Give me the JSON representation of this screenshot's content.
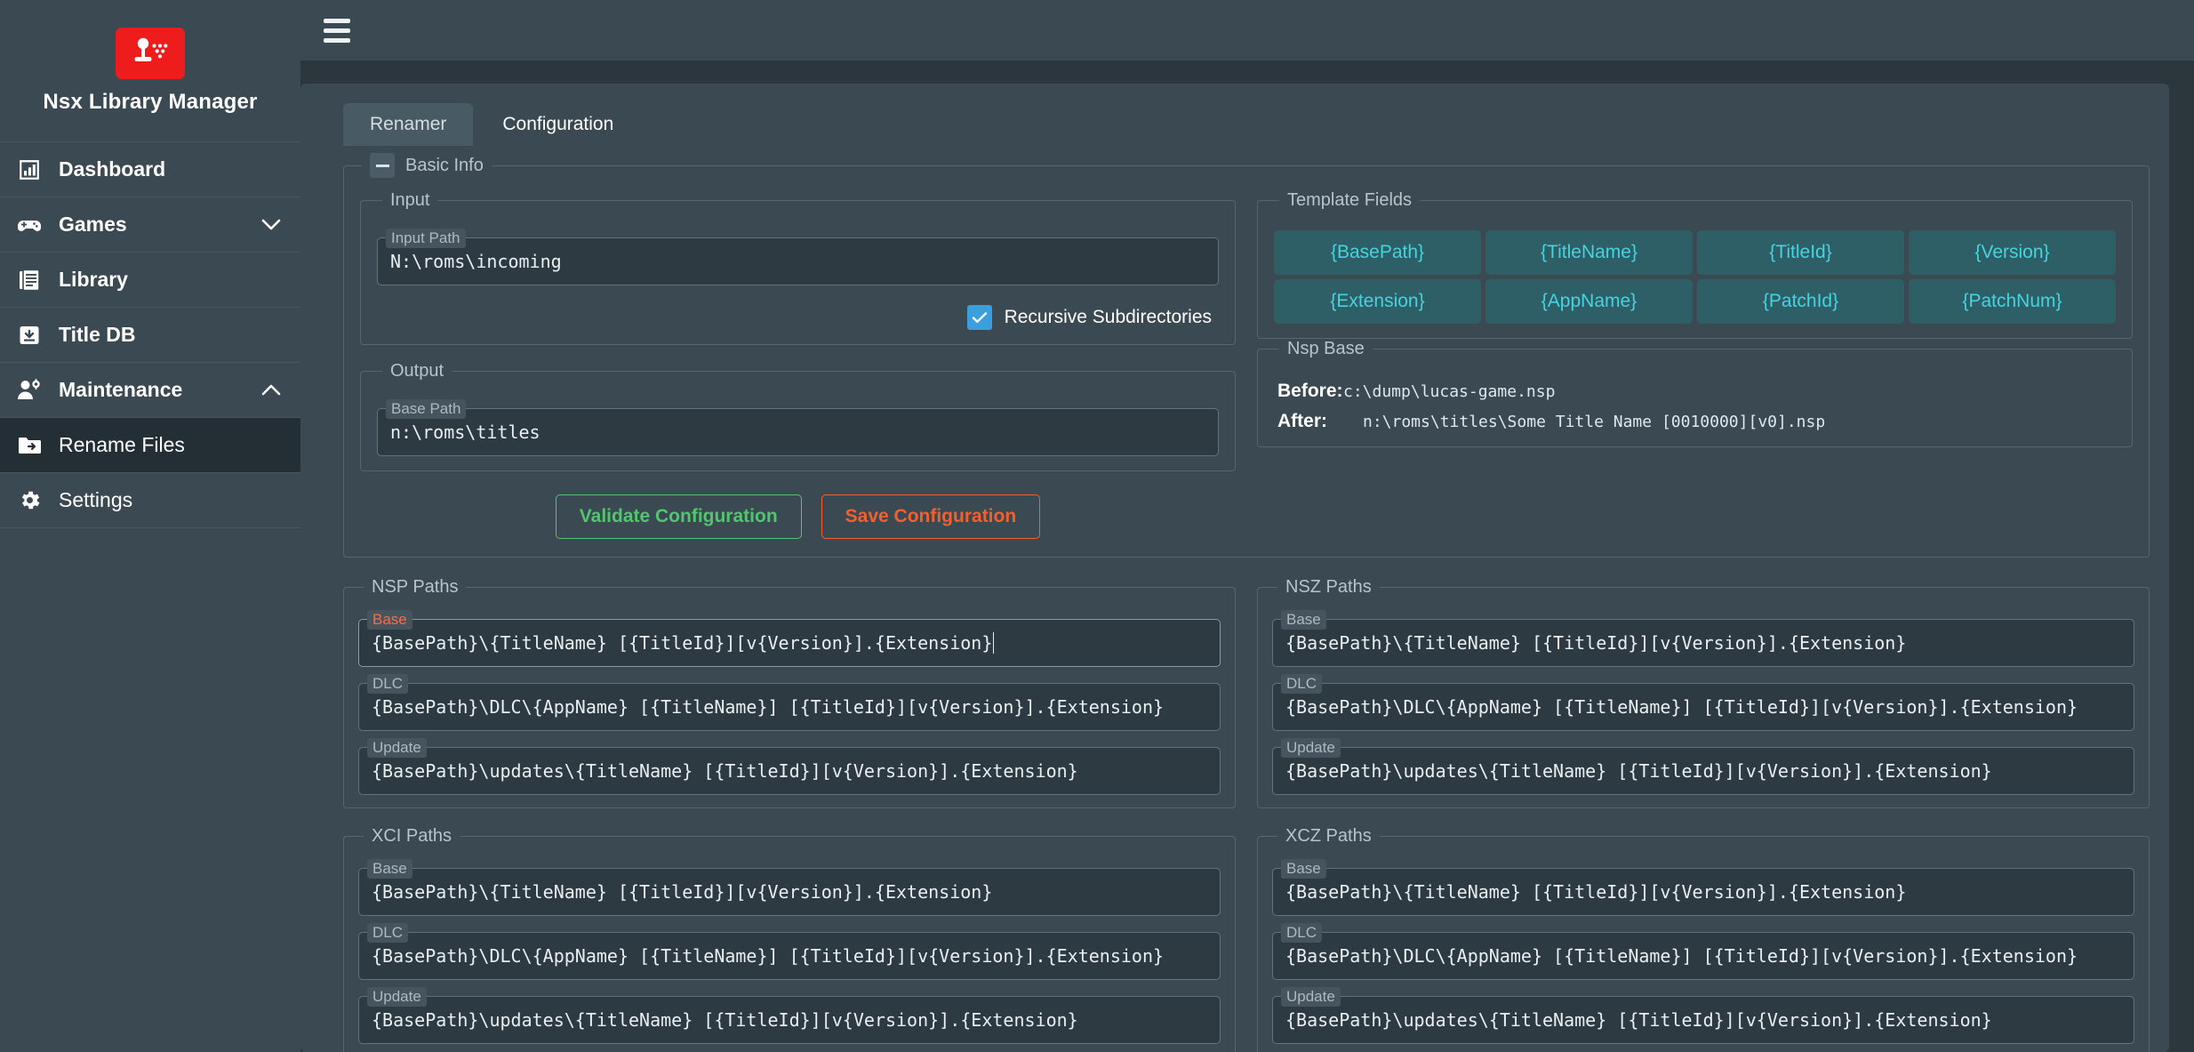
{
  "sidebar": {
    "brand_title": "Nsx Library Manager",
    "logo_icon": "joystick-icon",
    "items": [
      {
        "label": "Dashboard",
        "icon": "chart-bar-icon",
        "sub": false,
        "active": false,
        "chevron": ""
      },
      {
        "label": "Games",
        "icon": "gamepad-icon",
        "sub": false,
        "active": false,
        "chevron": "chevron-down-icon"
      },
      {
        "label": "Library",
        "icon": "books-icon",
        "sub": false,
        "active": false,
        "chevron": ""
      },
      {
        "label": "Title DB",
        "icon": "download-box-icon",
        "sub": false,
        "active": false,
        "chevron": ""
      },
      {
        "label": "Maintenance",
        "icon": "user-gear-icon",
        "sub": false,
        "active": false,
        "chevron": "chevron-up-icon"
      },
      {
        "label": "Rename Files",
        "icon": "folder-arrow-icon",
        "sub": true,
        "active": true,
        "chevron": ""
      },
      {
        "label": "Settings",
        "icon": "gear-icon",
        "sub": true,
        "active": false,
        "chevron": ""
      }
    ]
  },
  "topbar": {
    "menu_icon": "hamburger-menu-icon"
  },
  "tabs": [
    {
      "label": "Renamer",
      "active": false
    },
    {
      "label": "Configuration",
      "active": true
    }
  ],
  "basic_info": {
    "legend": "Basic Info",
    "collapse_icon": "minus-icon",
    "input": {
      "legend": "Input",
      "path_label": "Input Path",
      "path_value": "N:\\roms\\incoming",
      "recursive_label": "Recursive Subdirectories",
      "recursive_checked": true
    },
    "output": {
      "legend": "Output",
      "base_label": "Base Path",
      "base_value": "n:\\roms\\titles"
    },
    "buttons": {
      "validate": "Validate Configuration",
      "save": "Save Configuration"
    }
  },
  "template_fields": {
    "legend": "Template Fields",
    "chips": [
      "{BasePath}",
      "{TitleName}",
      "{TitleId}",
      "{Version}",
      "{Extension}",
      "{AppName}",
      "{PatchId}",
      "{PatchNum}"
    ]
  },
  "nsp_base_preview": {
    "legend": "Nsp Base",
    "before_label": "Before:",
    "before_value": "c:\\dump\\lucas-game.nsp",
    "after_label": "After:",
    "after_value": "n:\\roms\\titles\\Some Title Name [0010000][v0].nsp"
  },
  "path_groups": [
    {
      "legend": "NSP Paths",
      "fields": [
        {
          "label": "Base",
          "value": "{BasePath}\\{TitleName} [{TitleId}][v{Version}].{Extension}",
          "focused": true
        },
        {
          "label": "DLC",
          "value": "{BasePath}\\DLC\\{AppName} [{TitleName}] [{TitleId}][v{Version}].{Extension}",
          "focused": false
        },
        {
          "label": "Update",
          "value": "{BasePath}\\updates\\{TitleName} [{TitleId}][v{Version}].{Extension}",
          "focused": false
        }
      ]
    },
    {
      "legend": "NSZ Paths",
      "fields": [
        {
          "label": "Base",
          "value": "{BasePath}\\{TitleName} [{TitleId}][v{Version}].{Extension}",
          "focused": false
        },
        {
          "label": "DLC",
          "value": "{BasePath}\\DLC\\{AppName} [{TitleName}] [{TitleId}][v{Version}].{Extension}",
          "focused": false
        },
        {
          "label": "Update",
          "value": "{BasePath}\\updates\\{TitleName} [{TitleId}][v{Version}].{Extension}",
          "focused": false
        }
      ]
    },
    {
      "legend": "XCI Paths",
      "fields": [
        {
          "label": "Base",
          "value": "{BasePath}\\{TitleName} [{TitleId}][v{Version}].{Extension}",
          "focused": false
        },
        {
          "label": "DLC",
          "value": "{BasePath}\\DLC\\{AppName} [{TitleName}] [{TitleId}][v{Version}].{Extension}",
          "focused": false
        },
        {
          "label": "Update",
          "value": "{BasePath}\\updates\\{TitleName} [{TitleId}][v{Version}].{Extension}",
          "focused": false
        }
      ]
    },
    {
      "legend": "XCZ Paths",
      "fields": [
        {
          "label": "Base",
          "value": "{BasePath}\\{TitleName} [{TitleId}][v{Version}].{Extension}",
          "focused": false
        },
        {
          "label": "DLC",
          "value": "{BasePath}\\DLC\\{AppName} [{TitleName}] [{TitleId}][v{Version}].{Extension}",
          "focused": false
        },
        {
          "label": "Update",
          "value": "{BasePath}\\updates\\{TitleName} [{TitleId}][v{Version}].{Extension}",
          "focused": false
        }
      ]
    }
  ],
  "colors": {
    "brand_red": "#ef1c1c",
    "sidebar_bg": "#3b4a52",
    "page_bg": "#2b373d",
    "accent_cyan": "#45d3dd",
    "chip_bg": "#2f5f66",
    "checkbox_blue": "#3aa0dd",
    "validate_green": "#53c46f",
    "save_orange": "#f2602f",
    "focus_orange": "#ff6b42"
  }
}
